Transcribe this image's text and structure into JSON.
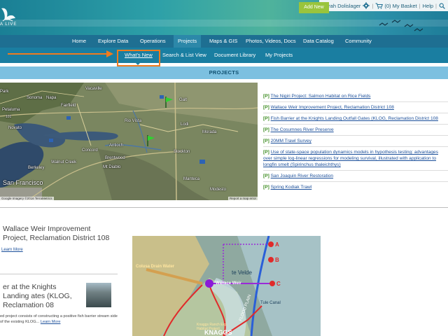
{
  "header": {
    "logo_text": "A LIVE",
    "user_name": "Sarah Dolislager",
    "basket_label": "(0) My Basket",
    "help_label": "Help"
  },
  "main_nav": {
    "items": [
      "Home",
      "Explore Data",
      "Operations",
      "Projects",
      "Maps & GIS",
      "Photos, Videos, Docs",
      "Data Catalog",
      "Community"
    ],
    "active": "Projects"
  },
  "sub_nav": {
    "items": [
      "What's New",
      "Search & List View",
      "Document Library",
      "My Projects"
    ],
    "add_new_label": "Add New",
    "active": "What's New"
  },
  "section_title": "PROJECTS",
  "map": {
    "labels": [
      "Park",
      "Sonoma",
      "Napa",
      "Vacaville",
      "Petaluma",
      "Fairfield",
      "Novato",
      "Rio Vista",
      "Lodi",
      "Concord",
      "Antioch",
      "Brentwood",
      "Walnut Creek",
      "Mt Diablo",
      "Stockton",
      "Berkeley",
      "San Francisco",
      "Manteca",
      "Modesto",
      "Galt",
      "Morada"
    ],
    "attribution": "Google Imagery ©2016 TerraMetrics",
    "report_label": "Report a map error",
    "road_label": "101"
  },
  "projects": [
    {
      "tag": "[P]",
      "title": "The Nigiri Project: Salmon Habitat on Rice Fields"
    },
    {
      "tag": "[P]",
      "title": "Wallace Weir Improvement Project, Reclamation District 108"
    },
    {
      "tag": "[P]",
      "title": "Fish Barrier at the Knights Landing Outfall Gates (KLOG, Reclamation District 108"
    },
    {
      "tag": "[P]",
      "title": "The Cosumnes River Preserve"
    },
    {
      "tag": "[P]",
      "title": "20MM Trawl Survey"
    },
    {
      "tag": "[P]",
      "title": "Use of state-space population dynamics models in hypothesis testing: advantages over simple log-linear regressions for modeling survival, illustrated with application to longfin smelt (Spirinchus thaleichthys)"
    },
    {
      "tag": "[P]",
      "title": "San Joaquin River Restoration"
    },
    {
      "tag": "[P]",
      "title": "Spring Kodiak Trawl"
    }
  ],
  "features": [
    {
      "title": "Wallace Weir Improvement Project, Reclamation District 108",
      "more_label": "Learn More"
    },
    {
      "title": "er at the Knights Landing ates (KLOG, Reclamation 08",
      "description": "ed project consists of constructing a positive fish barrier stream side of the existing KLOG...",
      "more_label": "Learn More"
    }
  ],
  "diagram": {
    "labels": [
      "Colusa Drain Water",
      "Wallace Weir",
      "te Velde",
      "Tule Canal",
      "FLOOD PLAIN",
      "Knaggs Ranch Exp. Habitat Project",
      "KNAGGS",
      "A",
      "B",
      "C"
    ]
  },
  "colors": {
    "nav_bg": "#1e6f92",
    "subnav_bg": "#1a7ea1",
    "add_new": "#9ac43c",
    "highlight": "#ef7b1e",
    "projects_bar": "#7cc0e0",
    "link": "#1b4f9a",
    "tag": "#3a8a1e"
  },
  "icons": [
    "gear-icon",
    "basket-icon",
    "search-icon",
    "arrow-right-annotation",
    "map-pin-icon"
  ]
}
